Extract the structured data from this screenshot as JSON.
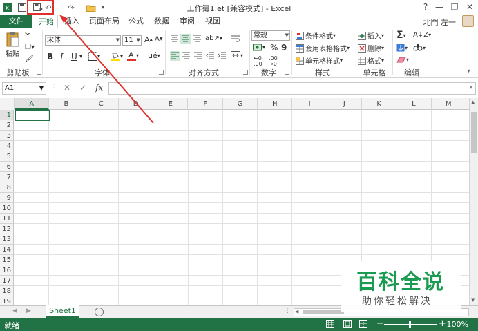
{
  "titlebar": {
    "title": "工作簿1.et  [兼容模式] - Excel",
    "help": "?",
    "minimize": "—",
    "restore": "❐",
    "close": "✕"
  },
  "tabs": {
    "file": "文件",
    "items": [
      "开始",
      "插入",
      "页面布局",
      "公式",
      "数据",
      "审阅",
      "视图"
    ],
    "active": "开始",
    "user": "北門 左一"
  },
  "ribbon": {
    "clipboard": {
      "label": "剪贴板",
      "paste": "粘贴"
    },
    "font": {
      "label": "字体",
      "name": "宋体",
      "size": "11",
      "bold": "B",
      "italic": "I",
      "underline": "U"
    },
    "alignment": {
      "label": "对齐方式"
    },
    "number": {
      "label": "数字",
      "format": "常规",
      "percent": "%",
      "comma": "9"
    },
    "styles": {
      "label": "样式",
      "cond": "条件格式",
      "table": "套用表格格式",
      "cell": "单元格样式"
    },
    "cells": {
      "label": "单元格",
      "insert": "插入",
      "delete": "删除",
      "format": "格式"
    },
    "editing": {
      "label": "编辑",
      "sum": "Σ"
    }
  },
  "formula_bar": {
    "name_box": "A1",
    "fx": "fx",
    "content": ""
  },
  "grid": {
    "columns": [
      "A",
      "B",
      "C",
      "D",
      "E",
      "F",
      "G",
      "H",
      "I",
      "J",
      "K",
      "L",
      "M"
    ],
    "rows": [
      "1",
      "2",
      "3",
      "4",
      "5",
      "6",
      "7",
      "8",
      "9",
      "10",
      "11",
      "12",
      "13",
      "14",
      "15",
      "16",
      "17",
      "18",
      "19"
    ],
    "selected_cell": "A1"
  },
  "sheets": {
    "items": [
      "Sheet1"
    ],
    "add": "+"
  },
  "status": {
    "text": "就绪",
    "zoom": "100%"
  },
  "watermark": {
    "title": "百科全说",
    "subtitle": "助你轻松解决"
  },
  "colors": {
    "accent": "#217346",
    "highlight": "#e0302c"
  }
}
